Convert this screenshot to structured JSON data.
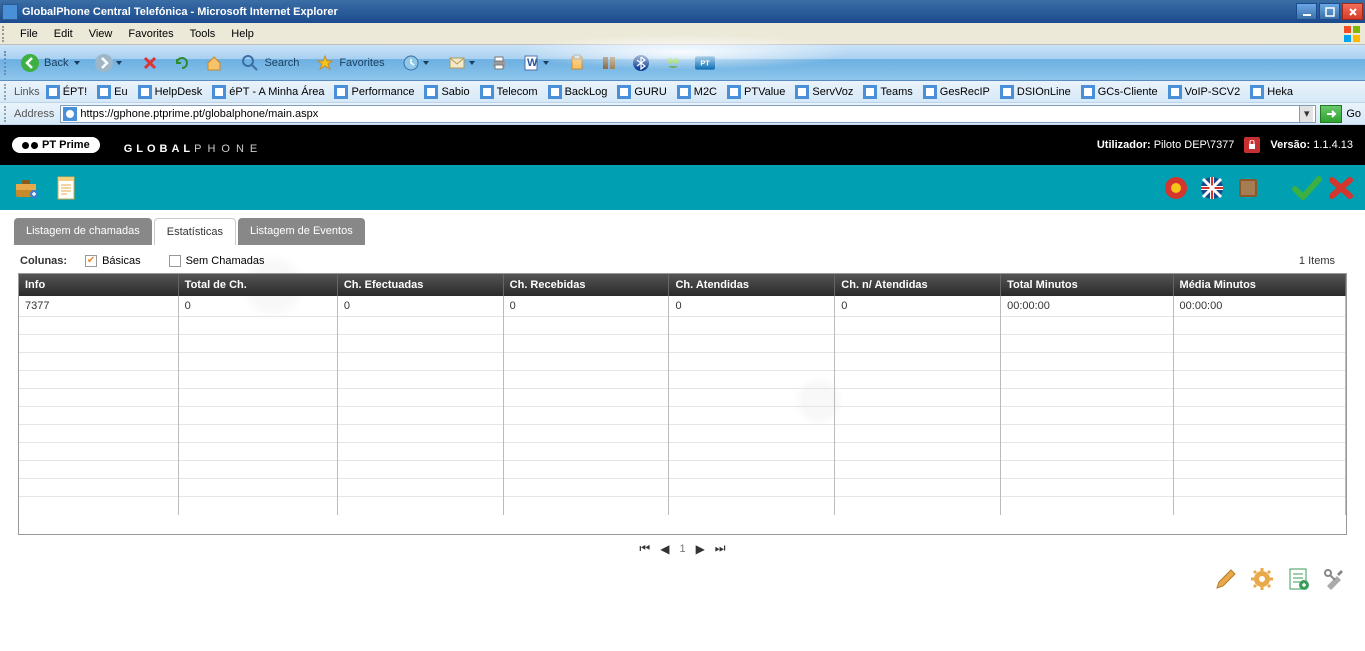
{
  "window": {
    "title": "GlobalPhone Central Telefónica - Microsoft Internet Explorer"
  },
  "menubar": [
    "File",
    "Edit",
    "View",
    "Favorites",
    "Tools",
    "Help"
  ],
  "toolbar": {
    "back": "Back",
    "search": "Search",
    "favorites": "Favorites"
  },
  "linksbar": {
    "label": "Links",
    "items": [
      "ÉPT!",
      "Eu",
      "HelpDesk",
      "éPT - A Minha Área",
      "Performance",
      "Sabio",
      "Telecom",
      "BackLog",
      "GURU",
      "M2C",
      "PTValue",
      "ServVoz",
      "Teams",
      "GesRecIP",
      "DSIOnLine",
      "GCs-Cliente",
      "VoIP-SCV2",
      "Heka"
    ]
  },
  "addressbar": {
    "label": "Address",
    "url": "https://gphone.ptprime.pt/globalphone/main.aspx",
    "go": "Go"
  },
  "appheader": {
    "brand": "PT Prime",
    "logo1": "GLOBAL",
    "logo2": "PHONE",
    "user_label": "Utilizador:",
    "user_value": "Piloto DEP\\7377",
    "version_label": "Versão:",
    "version_value": "1.1.4.13"
  },
  "tabs": {
    "items": [
      "Listagem de chamadas",
      "Estatísticas",
      "Listagem de Eventos"
    ],
    "active_index": 1
  },
  "filters": {
    "label": "Colunas:",
    "basic": "Básicas",
    "nocalls": "Sem Chamadas",
    "itemcount": "1 Items"
  },
  "table": {
    "headers": [
      "Info",
      "Total de Ch.",
      "Ch. Efectuadas",
      "Ch. Recebidas",
      "Ch. Atendidas",
      "Ch. n/ Atendidas",
      "Total Minutos",
      "Média Minutos"
    ],
    "rows": [
      [
        "7377",
        "0",
        "0",
        "0",
        "0",
        "0",
        "00:00:00",
        "00:00:00"
      ]
    ]
  },
  "pager": {
    "page": "1"
  }
}
